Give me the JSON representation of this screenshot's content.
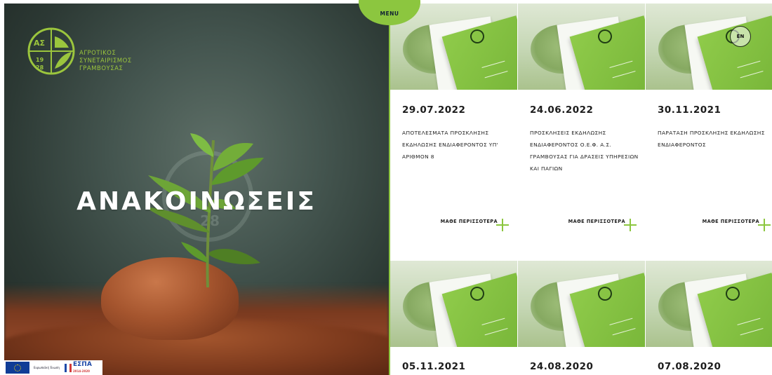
{
  "header": {
    "menu_label": "MENU",
    "lang_label": "EN"
  },
  "logo": {
    "mark_text": "ΑΣ",
    "year_top": "19",
    "year_bottom": "28",
    "lines": [
      "ΑΓΡΟΤΙΚΟΣ",
      "ΣΥΝΕΤΑΙΡΙΣΜΟΣ",
      "ΓΡΑΜΒΟΥΣΑΣ"
    ]
  },
  "hero": {
    "title": "ΑΝΑΚΟΙΝΩΣΕΙΣ",
    "watermark_year": "28"
  },
  "funding": {
    "eu_caption": "Ευρωπαϊκή Ένωση",
    "espa_label": "ΕΣΠΑ",
    "espa_years": "2014-2020"
  },
  "colors": {
    "accent": "#8cc63f",
    "text": "#1c1c1c"
  },
  "announcements": [
    {
      "date": "29.07.2022",
      "title": "ΑΠΟΤΕΛΕΣΜΑΤΑ ΠΡΟΣΚΛΗΣΗΣ ΕΚΔΗΛΩΣΗΣ ΕΝΔΙΑΦΕΡΟΝΤΟΣ ΥΠ' ΑΡΙΘΜΟΝ 8",
      "more_label": "ΜΑΘΕ ΠΕΡΙΣΣΟΤΕΡΑ"
    },
    {
      "date": "24.06.2022",
      "title": "ΠΡΟΣΚΛΗΣΕΙΣ ΕΚΔΗΛΩΣΗΣ ΕΝΔΙΑΦΕΡΟΝΤΟΣ Ο.Ε.Φ. Α.Σ. ΓΡΑΜΒΟΥΣΑΣ ΓΙΑ ΔΡΑΣΕΙΣ ΥΠΗΡΕΣΙΩΝ ΚΑΙ ΠΑΓΙΩΝ",
      "more_label": "ΜΑΘΕ ΠΕΡΙΣΣΟΤΕΡΑ"
    },
    {
      "date": "30.11.2021",
      "title": "ΠΑΡΑΤΑΣΗ ΠΡΟΣΚΛΗΣΗΣ ΕΚΔΗΛΩΣΗΣ ΕΝΔΙΑΦΕΡΟΝΤΟΣ",
      "more_label": "ΜΑΘΕ ΠΕΡΙΣΣΟΤΕΡΑ"
    },
    {
      "date": "05.11.2021"
    },
    {
      "date": "24.08.2020"
    },
    {
      "date": "07.08.2020"
    }
  ]
}
